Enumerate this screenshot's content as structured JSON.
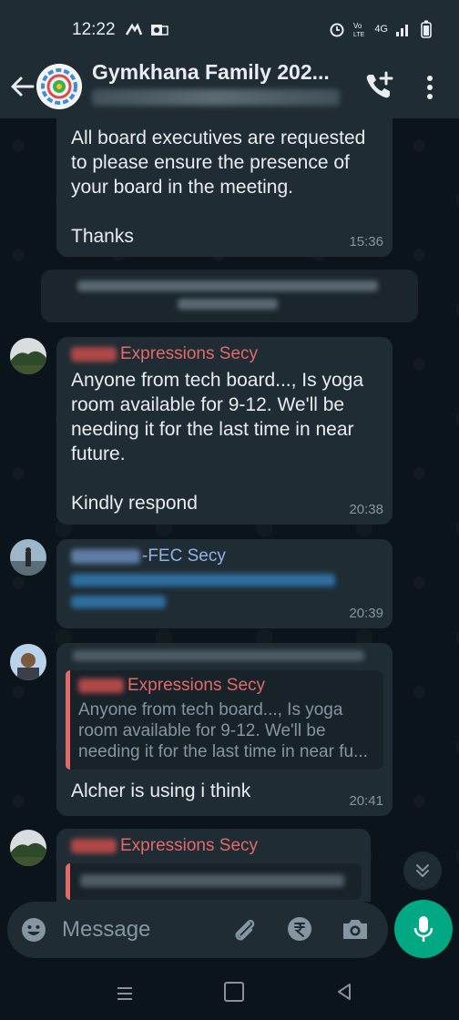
{
  "status_bar": {
    "time": "12:22",
    "network_label": "4G"
  },
  "header": {
    "title": "Gymkhana Family 202..."
  },
  "messages": {
    "m1": {
      "text": "All board executives are requested\nto please ensure the presence of\nyour board in the meeting.\n\nThanks",
      "time": "15:36"
    },
    "m2": {
      "sender": "Expressions Secy",
      "text": "Anyone from tech board..., Is yoga\nroom available for 9-12. We'll be\nneeding it for the last time in near\nfuture.\n\nKindly respond",
      "time": "20:38"
    },
    "m3": {
      "sender": "-FEC Secy",
      "time": "20:39"
    },
    "m4": {
      "quote_sender": "Expressions Secy",
      "quote_text": "Anyone from tech board..., Is yoga\nroom available for 9-12. We'll be\nneeding it for the last time in near fu...",
      "text": "Alcher is using i think",
      "time": "20:41"
    },
    "m5": {
      "quote_sender": "Expressions Secy"
    }
  },
  "composer": {
    "placeholder": "Message"
  },
  "colors": {
    "accent": "#00a884",
    "sender_red": "#e26a6a",
    "sender_blue": "#8fb4e6",
    "bubble": "#1f2c34",
    "background": "#0b141a"
  }
}
